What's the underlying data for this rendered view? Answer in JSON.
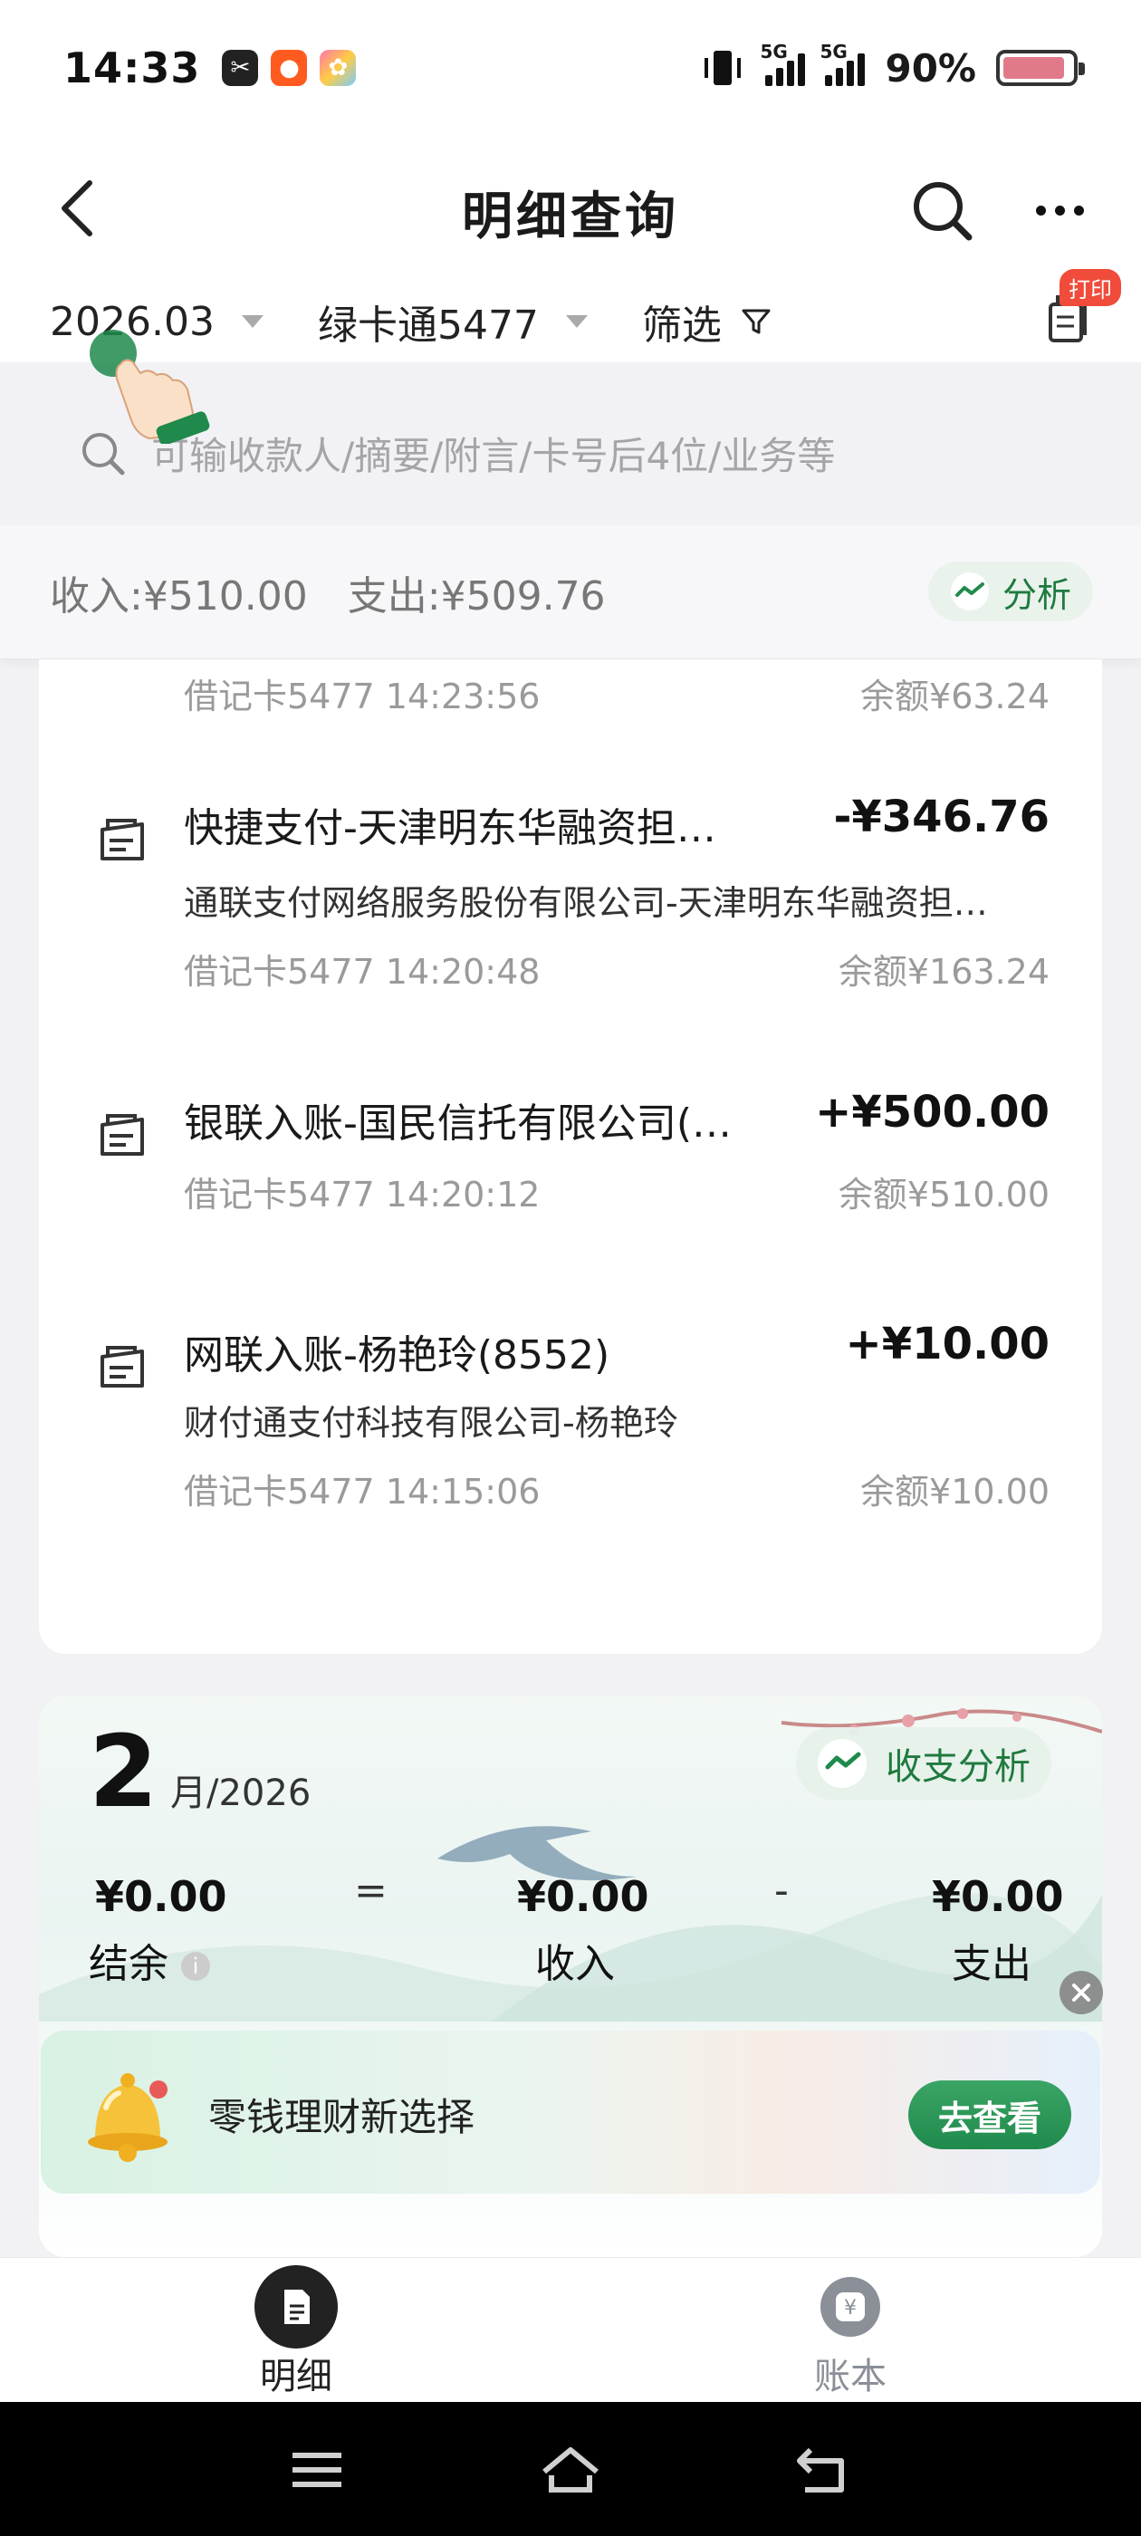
{
  "status_bar": {
    "time": "14:33",
    "network_tag_1": "5G",
    "network_tag_2": "5G",
    "battery": "90%",
    "battery_level": 0.9,
    "icons": [
      "capcut-icon",
      "kuaishou-icon",
      "gallery-icon",
      "vibrate-icon",
      "signal-icon",
      "battery-icon"
    ]
  },
  "header": {
    "title": "明细查询",
    "back_icon": "chevron-left-icon",
    "search_icon": "search-icon",
    "more_icon": "more-icon"
  },
  "filters": {
    "month": "2026.03",
    "card": "绿卡通5477",
    "filter_label": "筛选",
    "print_tag": "打印"
  },
  "search": {
    "placeholder": "可输收款人/摘要/附言/卡号后4位/业务等"
  },
  "summary": {
    "income": "收入:¥510.00",
    "expense": "支出:¥509.76",
    "analysis_label": "分析"
  },
  "records": [
    {
      "title": "",
      "amount": "",
      "subtitle": "",
      "meta": "借记卡5477 14:23:56",
      "balance": "余额¥63.24"
    },
    {
      "title": "快捷支付-天津明东华融资担…",
      "amount": "-¥346.76",
      "subtitle": "通联支付网络服务股份有限公司-天津明东华融资担…",
      "meta": "借记卡5477 14:20:48",
      "balance": "余额¥163.24"
    },
    {
      "title": "银联入账-国民信托有限公司(…",
      "amount": "+¥500.00",
      "subtitle": "",
      "meta": "借记卡5477 14:20:12",
      "balance": "余额¥510.00"
    },
    {
      "title": "网联入账-杨艳玲(8552)",
      "amount": "+¥10.00",
      "subtitle": "财付通支付科技有限公司-杨艳玲",
      "meta": "借记卡5477 14:15:06",
      "balance": "余额¥10.00"
    }
  ],
  "month_card": {
    "month": "2",
    "suffix": "月/2026",
    "analysis_label": "收支分析",
    "balance_value": "¥0.00",
    "balance_label": "结余",
    "equals": "=",
    "income_value": "¥0.00",
    "income_label": "收入",
    "minus": "-",
    "expense_value": "¥0.00",
    "expense_label": "支出",
    "info_icon": "i"
  },
  "promo": {
    "text": "零钱理财新选择",
    "button": "去查看"
  },
  "tabs": [
    {
      "label": "明细",
      "active": true
    },
    {
      "label": "账本",
      "active": false
    }
  ],
  "colors": {
    "brand_green": "#1f8a4c",
    "text_gray": "#9a9a9c",
    "print_red": "#f04b3b"
  }
}
